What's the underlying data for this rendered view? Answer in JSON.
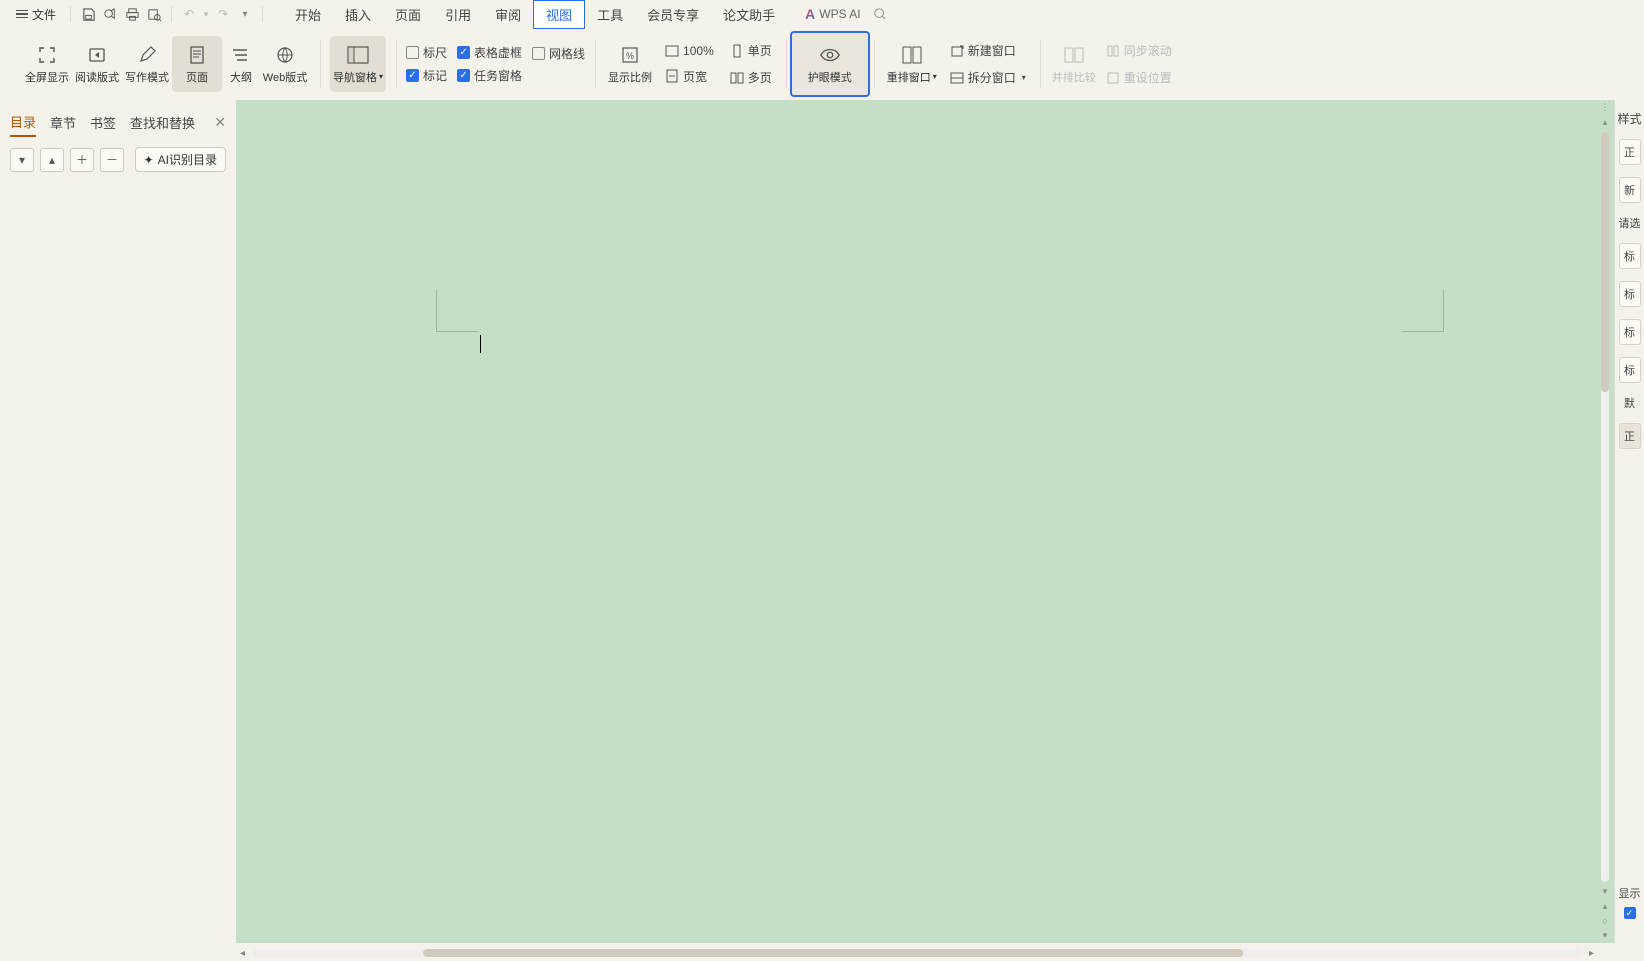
{
  "menu": {
    "file": "文件",
    "tabs": [
      "开始",
      "插入",
      "页面",
      "引用",
      "审阅",
      "视图",
      "工具",
      "会员专享",
      "论文助手"
    ],
    "active_tab": "视图",
    "wps_ai": "WPS AI"
  },
  "ribbon": {
    "views": {
      "fullscreen": "全屏显示",
      "reading": "阅读版式",
      "writing": "写作模式",
      "page": "页面",
      "outline": "大纲",
      "web": "Web版式"
    },
    "nav_pane": "导航窗格",
    "checks": {
      "ruler": "标尺",
      "table_frame": "表格虚框",
      "gridlines": "网格线",
      "marks": "标记",
      "task_pane": "任务窗格"
    },
    "zoom_group": {
      "zoom_ratio": "显示比例",
      "hundred": "100%",
      "single_page": "单页",
      "page_width": "页宽",
      "multi_page": "多页"
    },
    "eye_mode": "护眼模式",
    "window_group": {
      "arrange": "重排窗口",
      "new_window": "新建窗口",
      "split": "拆分窗口"
    },
    "compare_group": {
      "side_by_side": "并排比较",
      "sync_scroll": "同步滚动",
      "reset_pos": "重设位置"
    }
  },
  "nav": {
    "tabs": [
      "目录",
      "章节",
      "书签",
      "查找和替换"
    ],
    "active": "目录",
    "ai_rec": "AI识别目录"
  },
  "style_pane": {
    "head": "样式",
    "sel_hint": "请选",
    "show": "显示",
    "items": [
      "正",
      "新",
      "标",
      "标",
      "标",
      "标",
      "默",
      "正"
    ]
  }
}
